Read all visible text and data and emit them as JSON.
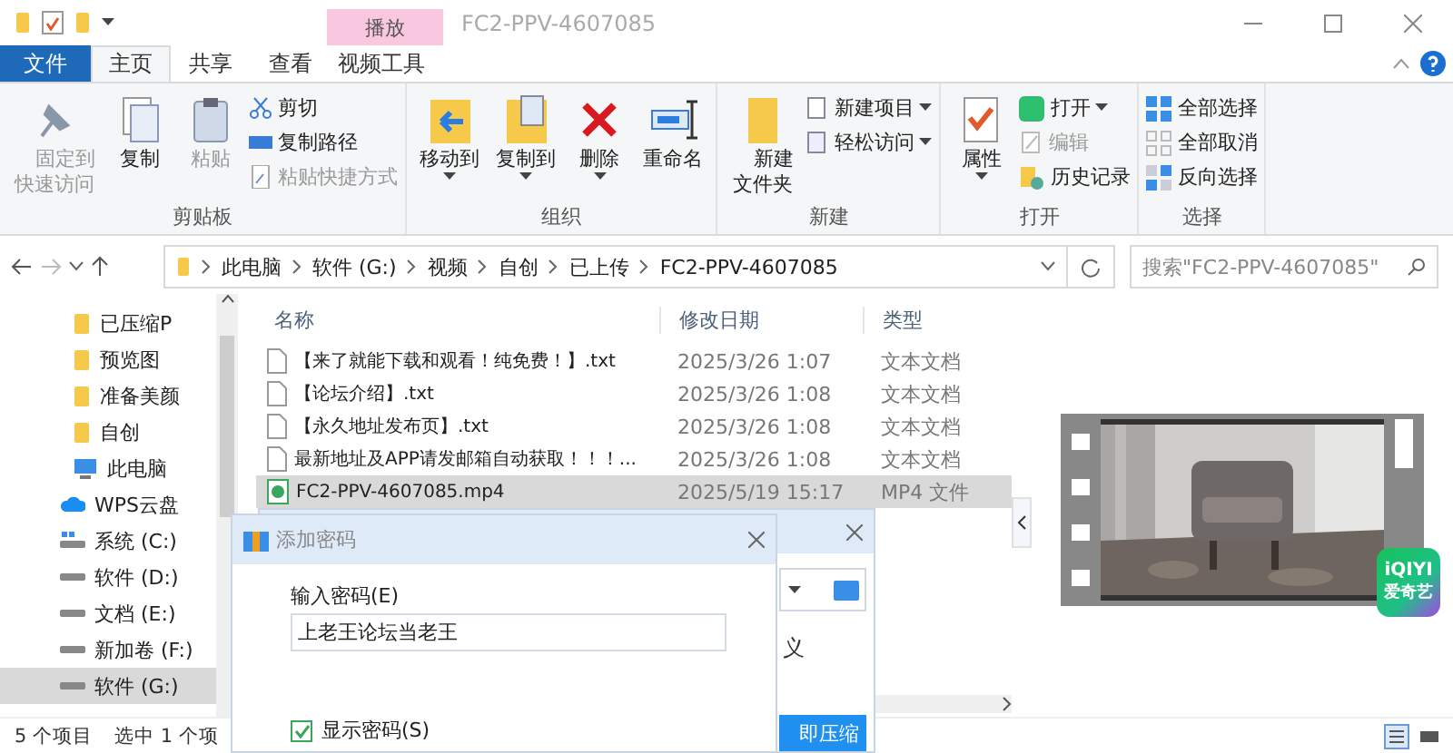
{
  "window": {
    "title": "FC2-PPV-4607085"
  },
  "ribbon_tabs": [
    {
      "label": "文件",
      "kind": "file",
      "selected": false
    },
    {
      "label": "主页",
      "kind": "tab",
      "selected": true
    },
    {
      "label": "共享",
      "kind": "tab",
      "selected": false
    },
    {
      "label": "查看",
      "kind": "tab",
      "selected": false
    }
  ],
  "context_group": {
    "label": "播放",
    "tabs": [
      {
        "label": "视频工具",
        "selected": false
      }
    ]
  },
  "ribbon_groups": [
    {
      "name": "剪贴板",
      "tools": [
        {
          "kind": "large",
          "label": "固定到快速访问",
          "disabled": true,
          "dropdown": false
        },
        {
          "kind": "large",
          "label": "复制",
          "disabled": false,
          "dropdown": false
        },
        {
          "kind": "large",
          "label": "粘贴",
          "disabled": true,
          "dropdown": false
        },
        {
          "kind": "small",
          "label": "剪切",
          "disabled": false,
          "dropdown": false
        },
        {
          "kind": "small",
          "label": "复制路径",
          "disabled": false,
          "dropdown": false
        },
        {
          "kind": "small",
          "label": "粘贴快捷方式",
          "disabled": true,
          "dropdown": false
        }
      ]
    },
    {
      "name": "组织",
      "tools": [
        {
          "kind": "large",
          "label": "移动到",
          "disabled": false,
          "dropdown": true
        },
        {
          "kind": "large",
          "label": "复制到",
          "disabled": false,
          "dropdown": true
        },
        {
          "kind": "large",
          "label": "删除",
          "disabled": false,
          "dropdown": true
        },
        {
          "kind": "large",
          "label": "重命名",
          "disabled": false,
          "dropdown": false
        }
      ]
    },
    {
      "name": "新建",
      "tools": [
        {
          "kind": "large",
          "label": "新建文件夹",
          "disabled": false,
          "dropdown": false
        },
        {
          "kind": "small",
          "label": "新建项目",
          "disabled": false,
          "dropdown": true
        },
        {
          "kind": "small",
          "label": "轻松访问",
          "disabled": false,
          "dropdown": true
        }
      ]
    },
    {
      "name": "打开",
      "tools": [
        {
          "kind": "large",
          "label": "属性",
          "disabled": false,
          "dropdown": true
        },
        {
          "kind": "small",
          "label": "打开",
          "disabled": false,
          "dropdown": true
        },
        {
          "kind": "small",
          "label": "编辑",
          "disabled": true,
          "dropdown": false
        },
        {
          "kind": "small",
          "label": "历史记录",
          "disabled": false,
          "dropdown": false
        }
      ]
    },
    {
      "name": "选择",
      "tools": [
        {
          "kind": "small",
          "label": "全部选择",
          "disabled": false,
          "dropdown": false
        },
        {
          "kind": "small",
          "label": "全部取消",
          "disabled": false,
          "dropdown": false
        },
        {
          "kind": "small",
          "label": "反向选择",
          "disabled": false,
          "dropdown": false
        }
      ]
    }
  ],
  "address": {
    "crumbs": [
      "此电脑",
      "软件 (G:)",
      "视频",
      "自创",
      "已上传",
      "FC2-PPV-4607085"
    ],
    "search_placeholder": "搜索\"FC2-PPV-4607085\""
  },
  "nav": [
    {
      "label": "已压缩P",
      "kind": "folder",
      "selected": false
    },
    {
      "label": "预览图",
      "kind": "folder",
      "selected": false
    },
    {
      "label": "准备美颜",
      "kind": "folder",
      "selected": false
    },
    {
      "label": "自创",
      "kind": "folder",
      "selected": false
    },
    {
      "label": "此电脑",
      "kind": "pc",
      "selected": false,
      "children": [
        {
          "label": "WPS云盘",
          "kind": "cloud",
          "selected": false
        },
        {
          "label": "系统 (C:)",
          "kind": "system",
          "selected": false
        },
        {
          "label": "软件 (D:)",
          "kind": "drive",
          "selected": false
        },
        {
          "label": "文档 (E:)",
          "kind": "drive",
          "selected": false
        },
        {
          "label": "新加卷 (F:)",
          "kind": "drive",
          "selected": false
        },
        {
          "label": "软件 (G:)",
          "kind": "drive",
          "selected": true
        }
      ]
    }
  ],
  "table": {
    "columns": [
      "名称",
      "修改日期",
      "类型"
    ],
    "rows": [
      {
        "name": "【来了就能下载和观看！纯免费！】.txt",
        "date": "2025/3/26 1:07",
        "type": "文本文档",
        "kind": "txt",
        "selected": false
      },
      {
        "name": "【论坛介绍】.txt",
        "date": "2025/3/26 1:08",
        "type": "文本文档",
        "kind": "txt",
        "selected": false
      },
      {
        "name": "【永久地址发布页】.txt",
        "date": "2025/3/26 1:08",
        "type": "文本文档",
        "kind": "txt",
        "selected": false
      },
      {
        "name": "最新地址及APP请发邮箱自动获取！！！...",
        "date": "2025/3/26 1:08",
        "type": "文本文档",
        "kind": "txt",
        "selected": false
      },
      {
        "name": "FC2-PPV-4607085.mp4",
        "date": "2025/5/19 15:17",
        "type": "MP4 文件",
        "kind": "video",
        "selected": true
      }
    ]
  },
  "preview": {
    "kind": "picture",
    "badge": [
      "iQIYI",
      "爱奇艺"
    ]
  },
  "status_bar": {
    "count": "5 个项目",
    "selection": "选中 1 个项"
  },
  "back_dialog": {
    "text": "义",
    "button": "即压缩"
  },
  "password_dialog": {
    "title": "添加密码",
    "field_label": "输入密码(E)",
    "value": "上老王论坛当老王",
    "checkbox": {
      "label": "显示密码(S)",
      "checked": true
    }
  }
}
